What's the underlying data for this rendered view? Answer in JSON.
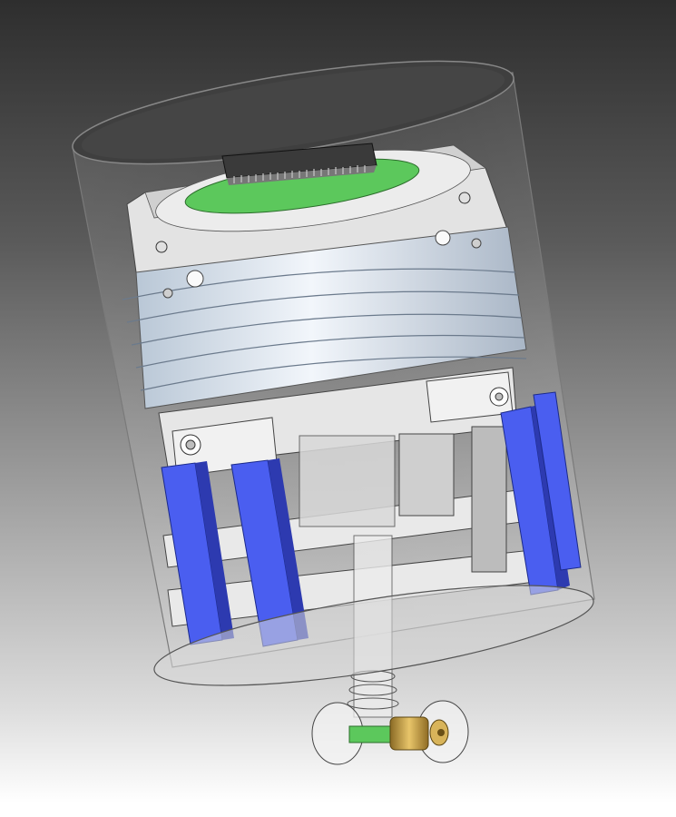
{
  "scene": {
    "kind": "cad-render",
    "colors": {
      "background_top": "#2e2e2e",
      "background_bottom": "#ffffff",
      "housing": "#c8c8c8",
      "metal_body": "#d6e2f0",
      "bracket": "#e6e6e6",
      "battery": "#4a5ef0",
      "pcb": "#5cc85c",
      "connector": "#3a3a3a",
      "brass": "#c8a048"
    },
    "components": [
      "transparent-cylinder-housing",
      "top-pcb-disk",
      "ribbon-connector",
      "upper-metal-body",
      "support-brackets",
      "battery-cells",
      "center-shaft",
      "bottom-plate",
      "lower-wheel-assembly"
    ]
  }
}
